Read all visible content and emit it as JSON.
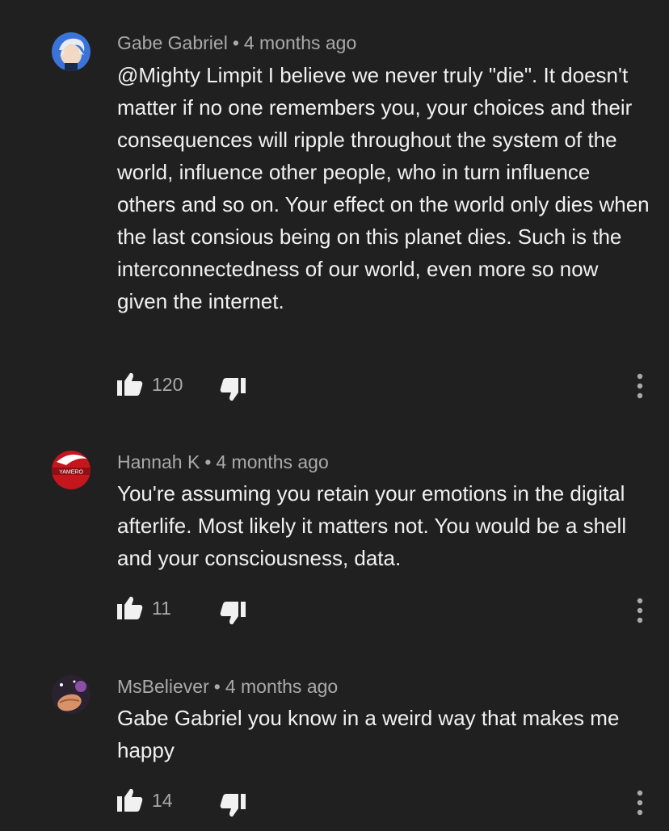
{
  "comments": [
    {
      "author": "Gabe Gabriel",
      "separator": "•",
      "time": "4 months ago",
      "text": "@Mighty Limpit I believe we never truly \"die\". It doesn't matter if no one remembers you, your choices and their consequences will ripple throughout the system of the world, influence other people, who in turn influence others and so on. Your effect on the world only dies when the last consious being on this planet dies. Such is the interconnectedness of our world, even more so now given the internet.",
      "likes": "120"
    },
    {
      "author": "Hannah K",
      "separator": "•",
      "time": "4 months ago",
      "text": "You're assuming you retain your emotions in the digital afterlife. Most likely it matters not. You would be a shell and your consciousness, data.",
      "likes": "11",
      "avatar_text": "YAMERO"
    },
    {
      "author": "MsBeliever",
      "separator": "•",
      "time": "4 months ago",
      "text": "Gabe Gabriel you know in a weird way that makes me happy",
      "likes": "14"
    }
  ],
  "icons": {
    "like": "thumbs-up-icon",
    "dislike": "thumbs-down-icon",
    "more": "more-vert-icon"
  },
  "colors": {
    "background": "#202020",
    "text": "#f1f1f1",
    "secondary": "#aaaaaa"
  }
}
